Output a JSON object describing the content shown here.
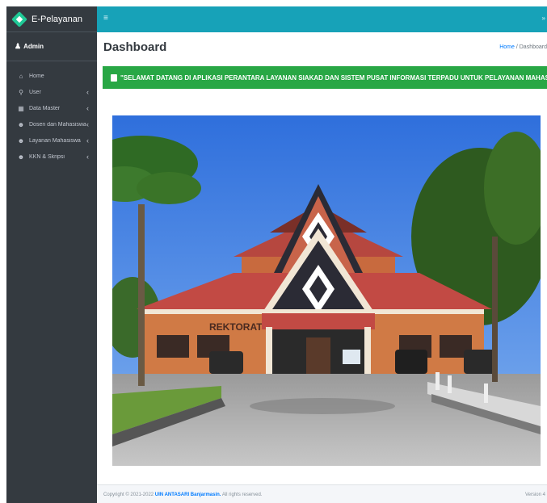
{
  "brand": {
    "name": "E-Pelayanan",
    "logo_icon": "diamond-logo-icon"
  },
  "user": {
    "name": "Admin",
    "icon": "user-icon"
  },
  "nav": {
    "items": [
      {
        "label": "Home",
        "icon": "home-icon",
        "has_children": false
      },
      {
        "label": "User",
        "icon": "key-icon",
        "has_children": true
      },
      {
        "label": "Data Master",
        "icon": "table-icon",
        "has_children": true
      },
      {
        "label": "Dosen dan Mahasiswa",
        "icon": "users-icon",
        "has_children": true
      },
      {
        "label": "Layanan Mahasiswa",
        "icon": "users-icon",
        "has_children": true
      },
      {
        "label": "KKN & Skripsi",
        "icon": "users-icon",
        "has_children": true
      }
    ],
    "chevron": "‹"
  },
  "topbar": {
    "menu_icon": "≡",
    "right_icon": "»"
  },
  "header": {
    "title": "Dashboard",
    "breadcrumb_home": "Home",
    "breadcrumb_separator": "/",
    "breadcrumb_current": "Dashboard"
  },
  "alert": {
    "text": "\"SELAMAT DATANG DI APLIKASI PERANTARA LAYANAN SIAKAD DAN SISTEM PUSAT INFORMASI TERPADU UNTUK PELAYANAN MAHASISWA\"",
    "icon": "info-icon"
  },
  "photo": {
    "building_sign": "REKTORAT"
  },
  "footer": {
    "copyright_prefix": "Copyright © 2021-2022 ",
    "link_text": "UIN ANTASARI Banjarmasin.",
    "suffix": " All rights reserved.",
    "version": "Version 4"
  },
  "colors": {
    "sidebar": "#343a40",
    "topbar": "#17a2b8",
    "alert": "#28a745",
    "link": "#007bff"
  }
}
